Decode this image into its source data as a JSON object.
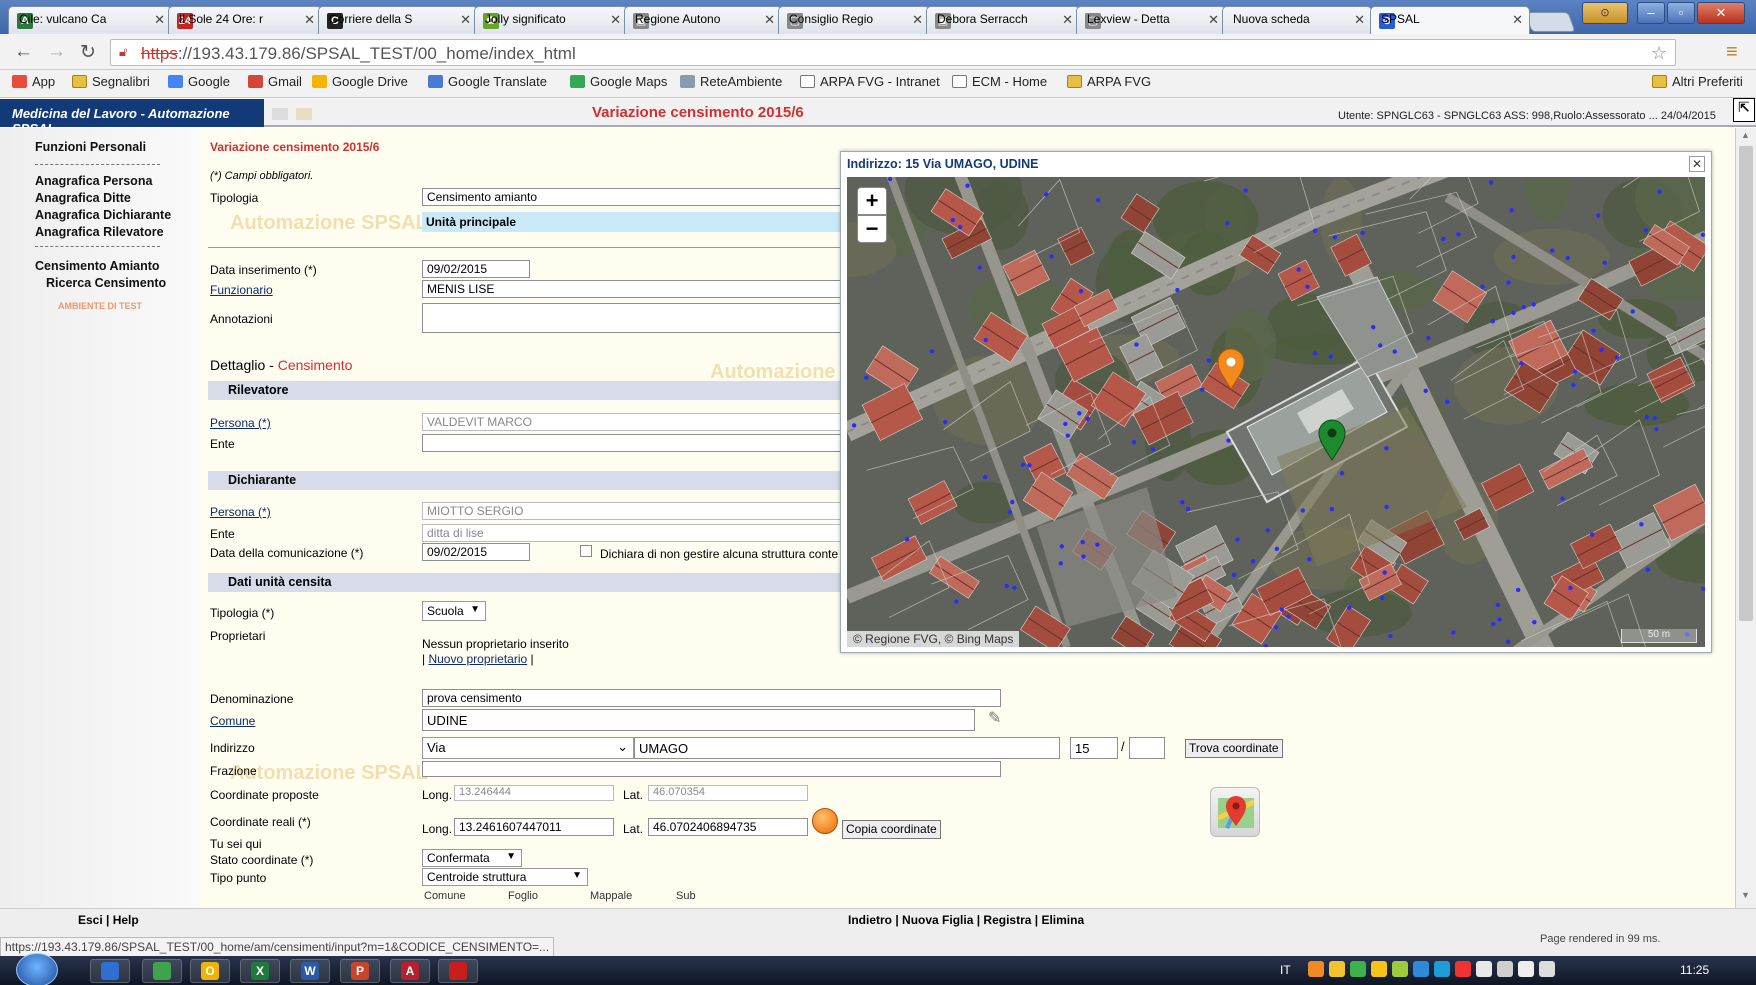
{
  "browser": {
    "tabs": [
      {
        "label": "Cile: vulcano Ca",
        "icon": "A",
        "color": "#2c7a3e"
      },
      {
        "label": "Il Sole 24 Ore: r",
        "icon": "24",
        "color": "#c42626"
      },
      {
        "label": "Corriere della S",
        "icon": "C",
        "color": "#222222"
      },
      {
        "label": "Jolly significato",
        "icon": "✿",
        "color": "#6aa32b"
      },
      {
        "label": "Regione Autono",
        "icon": "▣",
        "color": "#888888"
      },
      {
        "label": "Consiglio Regio",
        "icon": "▢",
        "color": "#888888"
      },
      {
        "label": "Debora Serracch",
        "icon": "▣",
        "color": "#888888"
      },
      {
        "label": "Lexview - Detta",
        "icon": "▢",
        "color": "#888888"
      },
      {
        "label": "Nuova scheda",
        "icon": "",
        "color": "#ffffff"
      },
      {
        "label": "SPSAL",
        "icon": "⊘",
        "color": "#2a5bd7"
      }
    ],
    "url_scheme": "https",
    "url_rest": "://193.43.179.86/SPSAL_TEST/00_home/index_html",
    "bookmarks": [
      "App",
      "Segnalibri",
      "Google",
      "Gmail",
      "Google Drive",
      "Google Translate",
      "Google Maps",
      "ReteAmbiente",
      "ARPA FVG - Intranet",
      "ECM - Home",
      "ARPA FVG"
    ],
    "other_bookmarks": "Altri Preferiti"
  },
  "app": {
    "title": "Medicina del Lavoro - Automazione SPSAL",
    "heading": "Variazione censimento 2015/6",
    "user_info": "Utente: SPNGLC63 - SPNGLC63 ASS: 998,Ruolo:Assessorato ... 24/04/2015",
    "watermark": "Automazione SPSAL"
  },
  "sidebar": {
    "section1": "Funzioni Personali",
    "items": [
      "Anagrafica Persona",
      "Anagrafica Ditte",
      "Anagrafica Dichiarante",
      "Anagrafica Rilevatore"
    ],
    "section2": "Censimento Amianto",
    "sub": "Ricerca Censimento",
    "env": "AMBIENTE DI TEST"
  },
  "form": {
    "title": "Variazione censimento 2015/6",
    "required_note": "(*) Campi obbligatori.",
    "tipologia_label": "Tipologia",
    "tipologia_value": "Censimento amianto",
    "unit_label": "Unità principale",
    "data_ins_label": "Data inserimento (*)",
    "data_ins_value": "09/02/2015",
    "funzionario_label": "Funzionario",
    "funzionario_value": "MENIS LISE",
    "annotazioni_label": "Annotazioni",
    "detail_prefix": "Dettaglio - ",
    "detail_red": "Censimento",
    "rilevatore_bar": "Rilevatore",
    "persona_label": "Persona (*)",
    "rilevatore_persona": "VALDEVIT MARCO",
    "ente_label": "Ente",
    "dichiarante_bar": "Dichiarante",
    "dichiarante_persona": "MIOTTO SERGIO",
    "dichiarante_ente": "ditta di lise",
    "data_com_label": "Data della comunicazione (*)",
    "data_com_value": "09/02/2015",
    "dichiara_label": "Dichiara di non gestire alcuna struttura conte",
    "unit_bar": "Dati unità censita",
    "tipologia_req_label": "Tipologia (*)",
    "tipologia_req_value": "Scuola",
    "proprietari_label": "Proprietari",
    "proprietari_none": "Nessun proprietario inserito",
    "nuovo_proprietario": "Nuovo proprietario",
    "denominazione_label": "Denominazione",
    "denominazione_value": "prova censimento",
    "comune_label": "Comune",
    "comune_value": "UDINE",
    "indirizzo_label": "Indirizzo",
    "indirizzo_tipo": "Via",
    "indirizzo_nome": "UMAGO",
    "indirizzo_civico": "15",
    "trova_btn": "Trova coordinate",
    "frazione_label": "Frazione",
    "coord_prop_label": "Coordinate proposte",
    "long_label": "Long.",
    "lat_label": "Lat.",
    "long_prop": "13.246444",
    "lat_prop": "46.070354",
    "coord_real_label": "Coordinate reali (*)",
    "long_real": "13.2461607447011",
    "lat_real": "46.0702406894735",
    "copia_btn": "Copia coordinate",
    "tu_sei_qui": "Tu sei qui",
    "stato_label": "Stato coordinate (*)",
    "stato_value": "Confermata",
    "tipo_punto_label": "Tipo punto",
    "tipo_punto_value": "Centroide struttura",
    "cat_cols": [
      "Comune",
      "Foglio",
      "Mappale",
      "Sub"
    ]
  },
  "map": {
    "title": "Indirizzo: 15 Via UMAGO, UDINE",
    "attribution": "© Regione FVG, © Bing Maps",
    "scale": "50 m",
    "pin_colors": {
      "proposed": "#f28a1c",
      "real": "#1e8a2f"
    }
  },
  "footer": {
    "esci": "Esci",
    "help": "Help",
    "actions": [
      "Indietro",
      "Nuova Figlia",
      "Registra",
      "Elimina"
    ],
    "rendered": "Page rendered in 99 ms.",
    "status_url": "https://193.43.179.86/SPSAL_TEST/00_home/am/censimenti/input?m=1&CODICE_CENSIMENTO=..."
  },
  "taskbar": {
    "apps": [
      "",
      "",
      "O",
      "X",
      "W",
      "P",
      "A",
      ""
    ],
    "lang": "IT",
    "clock": "11:25"
  }
}
